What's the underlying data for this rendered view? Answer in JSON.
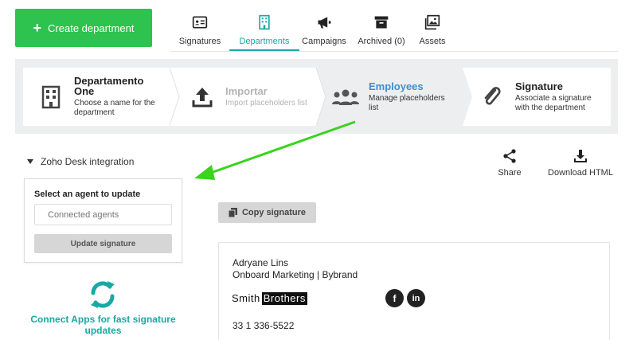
{
  "toolbar": {
    "create_label": "Create department"
  },
  "tabs": [
    {
      "label": "Signatures",
      "icon": "id-card-icon"
    },
    {
      "label": "Departments",
      "icon": "building-icon",
      "active": true
    },
    {
      "label": "Campaigns",
      "icon": "megaphone-icon"
    },
    {
      "label": "Archived (0)",
      "icon": "archive-box-icon"
    },
    {
      "label": "Assets",
      "icon": "images-icon"
    }
  ],
  "steps": [
    {
      "title": "Departamento One",
      "title_line1": "Departamento",
      "title_line2": "One",
      "desc_line1": "Choose a name for the",
      "desc_line2": "department",
      "state": "done"
    },
    {
      "title": "Importar",
      "desc_line1": "Import placeholders list",
      "state": "disabled"
    },
    {
      "title": "Employees",
      "desc_line1": "Manage placeholders",
      "desc_line2": "list",
      "state": "current"
    },
    {
      "title": "Signature",
      "desc_line1": "Associate a signature",
      "desc_line2": "with the department",
      "state": "pending"
    }
  ],
  "zoho": {
    "toggle_label": "Zoho Desk integration",
    "select_label": "Select an agent to update",
    "agent_placeholder": "Connected agents",
    "update_label": "Update signature",
    "connect_line1": "Connect Apps for fast signature",
    "connect_line2": "updates"
  },
  "actions": {
    "share_label": "Share",
    "download_label": "Download HTML"
  },
  "copy_label": "Copy signature",
  "signature": {
    "name": "Adryane Lins",
    "role": "Onboard Marketing | Bybrand",
    "logo_part1": "Smith",
    "logo_part2": "Brothers",
    "phone": "33 1 336-5522",
    "social": [
      "f",
      "in"
    ]
  },
  "colors": {
    "accent": "#17a9a4",
    "create_button": "#2ec24f",
    "current_step": "#3d8fd1",
    "annotation_arrow": "#3ad31e"
  }
}
